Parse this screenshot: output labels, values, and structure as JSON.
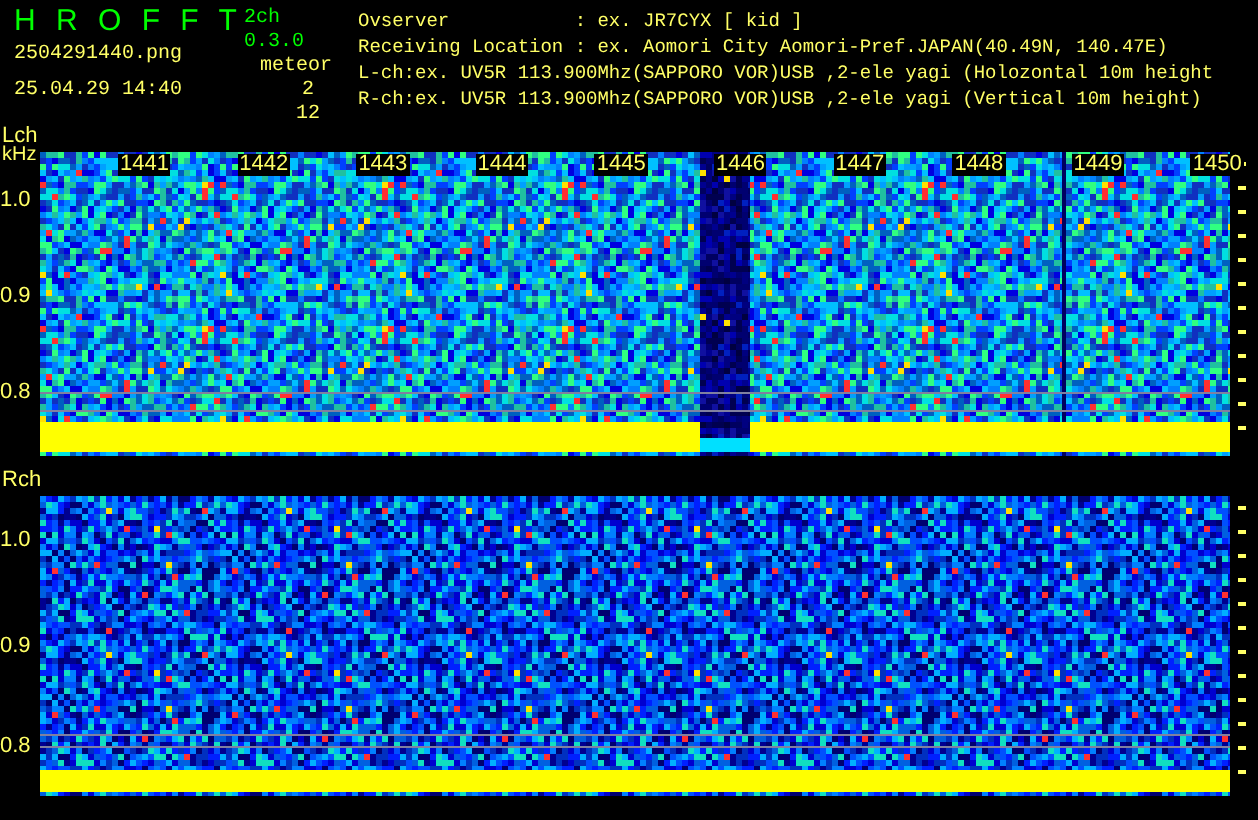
{
  "app": {
    "title": "H R O F F T",
    "version": "2ch 0.3.0",
    "mode": "meteor",
    "file": "2504291440.png",
    "timestamp": "25.04.29 14:40",
    "counts": [
      "2",
      "12"
    ]
  },
  "info_lines": [
    "Ovserver           : ex. JR7CYX [ kid ]",
    "Receiving Location : ex. Aomori City Aomori-Pref.JAPAN(40.49N, 140.47E)",
    "L-ch:ex. UV5R 113.900Mhz(SAPPORO VOR)USB ,2-ele yagi (Holozontal 10m height",
    "R-ch:ex. UV5R 113.900Mhz(SAPPORO VOR)USB ,2-ele yagi (Vertical 10m height)"
  ],
  "channels": [
    {
      "label": "Lch",
      "unit": "kHz",
      "time_labels": [
        "1441",
        "1442",
        "1443",
        "1444",
        "1445",
        "1446",
        "1447",
        "1448",
        "1449",
        "1450"
      ],
      "y_ticks": [
        "1.0",
        "0.9",
        "0.8"
      ]
    },
    {
      "label": "Rch",
      "y_ticks": [
        "1.0",
        "0.9",
        "0.8"
      ]
    }
  ]
}
